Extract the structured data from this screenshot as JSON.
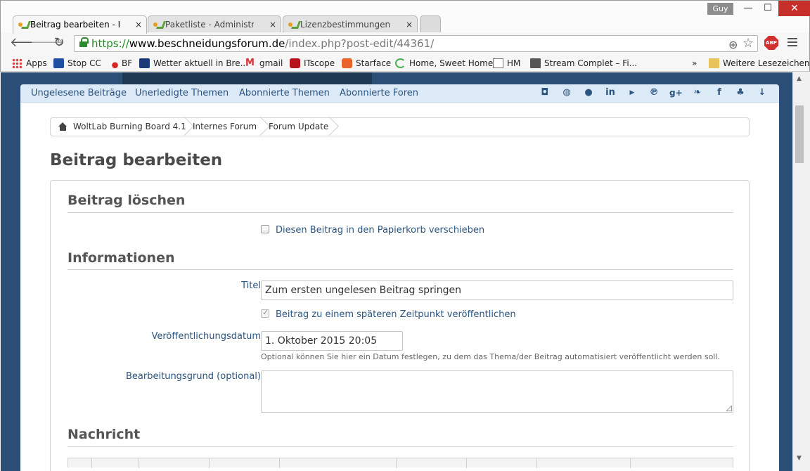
{
  "window": {
    "user": "Guy",
    "minimize_glyph": "—",
    "maximize_glyph": "☐",
    "close_glyph": "✕"
  },
  "tabs": [
    {
      "title": "Beitrag bearbeiten - Forum",
      "close": "×"
    },
    {
      "title": "Paketliste - Administration",
      "close": "×"
    },
    {
      "title": "Lizenzbestimmungen - To",
      "close": "×"
    }
  ],
  "address": {
    "scheme": "https://",
    "host": "www.beschneidungsforum.de",
    "path": "/index.php?post-edit/44361/",
    "abp": "ABP"
  },
  "bookmarks": {
    "items": [
      {
        "label": "Apps"
      },
      {
        "label": "Stop CC"
      },
      {
        "label": "BF"
      },
      {
        "label": "Wetter aktuell in Bre..."
      },
      {
        "label": "gmail"
      },
      {
        "label": "ITscope"
      },
      {
        "label": "Starface"
      },
      {
        "label": "Home, Sweet Home"
      },
      {
        "label": "HM"
      },
      {
        "label": "Stream Complet – Fi..."
      }
    ],
    "overflow": "»",
    "other": "Weitere Lesezeichen"
  },
  "subnav": {
    "links": [
      "Ungelesene Beiträge",
      "Unerledigte Themen",
      "Abonnierte Themen",
      "Abonnierte Foren"
    ],
    "social": [
      "instagram-icon",
      "dribbble-icon",
      "github-icon",
      "linkedin-icon",
      "youtube-icon",
      "pinterest-icon",
      "google-plus-icon",
      "twitter-icon",
      "facebook-icon",
      "sitemap-icon",
      "arrow-down-icon"
    ]
  },
  "breadcrumb": [
    "WoltLab Burning Board 4.1",
    "Internes Forum",
    "Forum Update"
  ],
  "page": {
    "title": "Beitrag bearbeiten"
  },
  "form": {
    "delete_section": "Beitrag löschen",
    "trash_label": "Diesen Beitrag in den Papierkorb verschieben",
    "trash_checked": false,
    "info_section": "Informationen",
    "title_label": "Titel",
    "title_value": "Zum ersten ungelesen Beitrag springen",
    "schedule_label": "Beitrag zu einem späteren Zeitpunkt veröffentlichen",
    "schedule_checked": true,
    "date_label": "Veröffentlichungsdatum",
    "date_value": "1. Oktober 2015 20:05",
    "date_help": "Optional können Sie hier ein Datum festlegen, zu dem das Thema/der Beitrag automatisiert veröffentlicht werden soll.",
    "reason_label": "Bearbeitungsgrund (optional)",
    "reason_value": "",
    "message_section": "Nachricht"
  },
  "colors": {
    "page_background": "#2b4e76",
    "link": "#2c5580",
    "subnav_background": "#dce9f7"
  }
}
